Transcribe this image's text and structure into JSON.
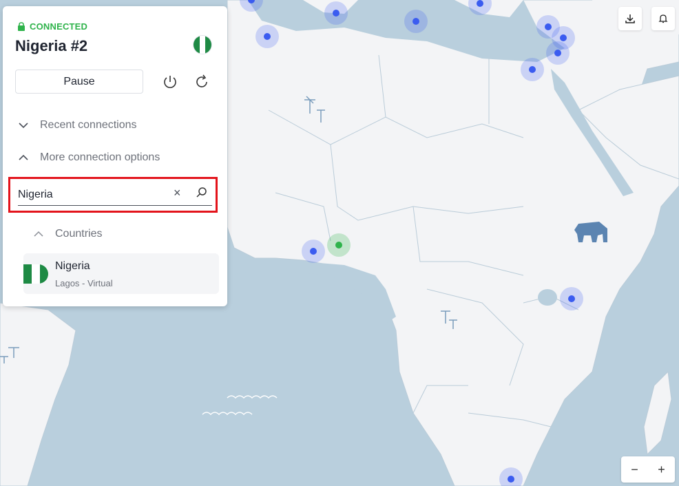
{
  "connection": {
    "status": "CONNECTED",
    "server_name": "Nigeria #2"
  },
  "controls": {
    "pause_label": "Pause"
  },
  "sections": {
    "recent": "Recent connections",
    "more": "More connection options",
    "countries": "Countries"
  },
  "search": {
    "value": "Nigeria"
  },
  "results": [
    {
      "name": "Nigeria",
      "sub": "Lagos - Virtual"
    }
  ],
  "zoom": {
    "out": "−",
    "in": "+"
  },
  "colors": {
    "connected": "#2fb34b",
    "server_dot": "#3b5cf0",
    "highlight_border": "#e3131b"
  }
}
